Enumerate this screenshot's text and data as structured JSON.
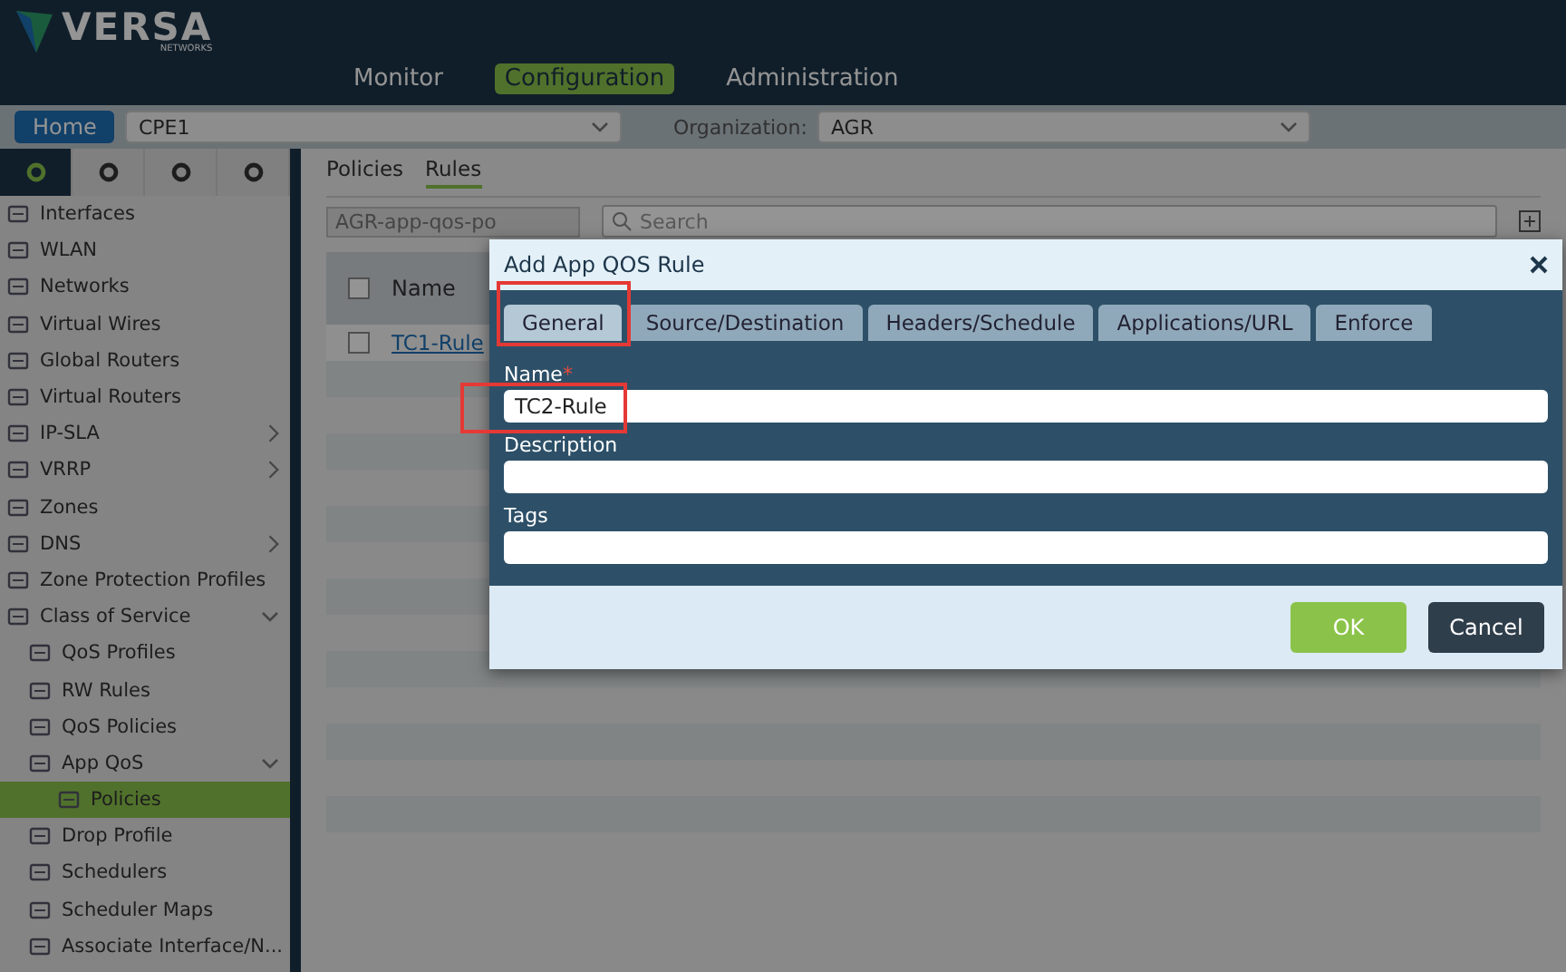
{
  "logo": {
    "name": "VERSA",
    "sub": "NETWORKS"
  },
  "nav": [
    {
      "label": "Monitor",
      "selected": false
    },
    {
      "label": "Configuration",
      "selected": true
    },
    {
      "label": "Administration",
      "selected": false
    }
  ],
  "toolbar": {
    "home": "Home",
    "device": "CPE1",
    "org_label": "Organization:",
    "org": "AGR"
  },
  "sidebar": {
    "icon_tabs": [
      {
        "selected": true
      },
      {
        "selected": false
      },
      {
        "selected": false
      },
      {
        "selected": false
      }
    ],
    "items": [
      {
        "label": "Interfaces",
        "selected": false
      },
      {
        "label": "WLAN",
        "selected": false
      },
      {
        "label": "Networks",
        "selected": false
      },
      {
        "label": "Virtual Wires",
        "selected": false
      },
      {
        "label": "Global Routers",
        "selected": false
      },
      {
        "label": "Virtual Routers",
        "selected": false
      },
      {
        "label": "IP-SLA",
        "selected": false,
        "expanded": false
      },
      {
        "label": "VRRP",
        "selected": false,
        "expanded": false
      },
      {
        "label": "Zones",
        "selected": false
      },
      {
        "label": "DNS",
        "selected": false,
        "expanded": false
      },
      {
        "label": "Zone Protection Profiles",
        "selected": false
      },
      {
        "label": "Class of Service",
        "selected": false,
        "expanded": true,
        "children": [
          {
            "label": "QoS Profiles",
            "selected": false
          },
          {
            "label": "RW Rules",
            "selected": false
          },
          {
            "label": "QoS Policies",
            "selected": false
          },
          {
            "label": "App QoS",
            "selected": false,
            "expanded": true,
            "children": [
              {
                "label": "Policies",
                "selected": true
              }
            ]
          },
          {
            "label": "Drop Profile",
            "selected": false
          },
          {
            "label": "Schedulers",
            "selected": false
          },
          {
            "label": "Scheduler Maps",
            "selected": false
          },
          {
            "label": "Associate Interface/N...",
            "selected": false
          }
        ]
      }
    ]
  },
  "tabs": [
    {
      "label": "Policies",
      "selected": false
    },
    {
      "label": "Rules",
      "selected": true
    }
  ],
  "policy_select": "AGR-app-qos-po",
  "search": {
    "placeholder": "Search"
  },
  "table": {
    "all_checked": false,
    "columns": [
      "Name"
    ],
    "rows": [
      {
        "name": "TC1-Rule",
        "checked": false
      }
    ]
  },
  "dialog": {
    "title": "Add App QOS Rule",
    "tabs": [
      {
        "label": "General",
        "selected": true
      },
      {
        "label": "Source/Destination",
        "selected": false
      },
      {
        "label": "Headers/Schedule",
        "selected": false
      },
      {
        "label": "Applications/URL",
        "selected": false
      },
      {
        "label": "Enforce",
        "selected": false
      }
    ],
    "required_mark": "*",
    "fields": [
      {
        "label": "Name",
        "required": true,
        "value": "TC2-Rule"
      },
      {
        "label": "Description",
        "required": false
      },
      {
        "label": "Tags",
        "required": false
      }
    ],
    "buttons": [
      {
        "label": "OK",
        "kind": "primary"
      },
      {
        "label": "Cancel",
        "kind": "secondary"
      }
    ]
  }
}
